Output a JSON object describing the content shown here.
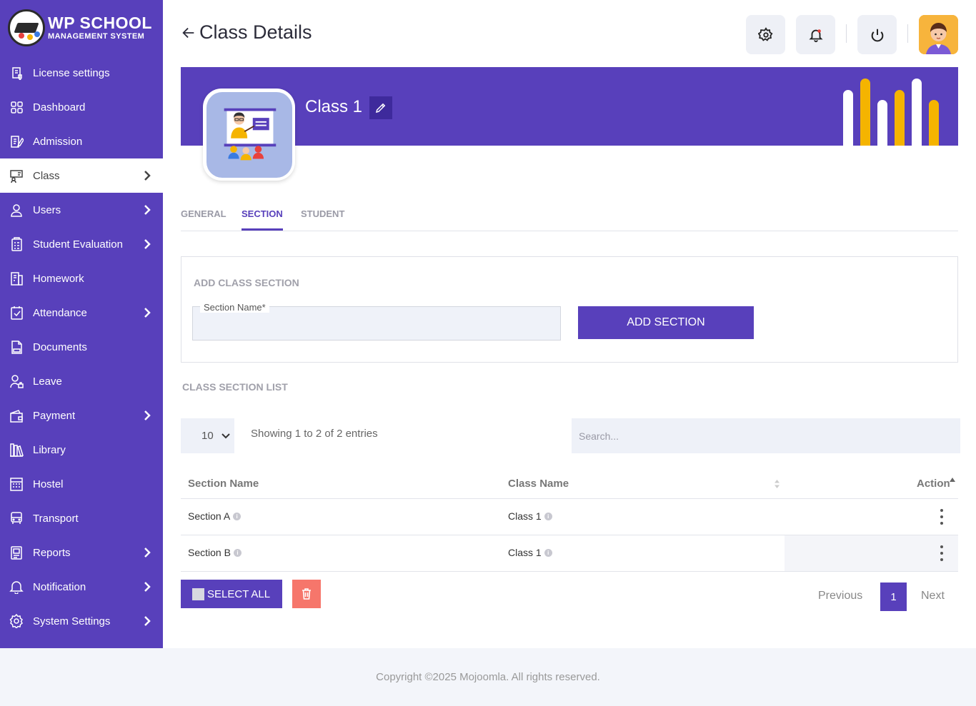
{
  "logo": {
    "title": "WP SCHOOL",
    "subtitle": "MANAGEMENT SYSTEM"
  },
  "sidebar": {
    "items": [
      {
        "label": "License settings",
        "icon": "license-icon",
        "chevron": false,
        "active": false
      },
      {
        "label": "Dashboard",
        "icon": "dashboard-icon",
        "chevron": false,
        "active": false
      },
      {
        "label": "Admission",
        "icon": "admission-icon",
        "chevron": false,
        "active": false
      },
      {
        "label": "Class",
        "icon": "class-icon",
        "chevron": true,
        "active": true
      },
      {
        "label": "Users",
        "icon": "user-icon",
        "chevron": true,
        "active": false
      },
      {
        "label": "Student Evaluation",
        "icon": "evaluation-icon",
        "chevron": true,
        "active": false
      },
      {
        "label": "Homework",
        "icon": "homework-icon",
        "chevron": false,
        "active": false
      },
      {
        "label": "Attendance",
        "icon": "attendance-icon",
        "chevron": true,
        "active": false
      },
      {
        "label": "Documents",
        "icon": "documents-icon",
        "chevron": false,
        "active": false
      },
      {
        "label": "Leave",
        "icon": "leave-icon",
        "chevron": false,
        "active": false
      },
      {
        "label": "Payment",
        "icon": "payment-icon",
        "chevron": true,
        "active": false
      },
      {
        "label": "Library",
        "icon": "library-icon",
        "chevron": false,
        "active": false
      },
      {
        "label": "Hostel",
        "icon": "hostel-icon",
        "chevron": false,
        "active": false
      },
      {
        "label": "Transport",
        "icon": "transport-icon",
        "chevron": false,
        "active": false
      },
      {
        "label": "Reports",
        "icon": "reports-icon",
        "chevron": true,
        "active": false
      },
      {
        "label": "Notification",
        "icon": "notification-icon",
        "chevron": true,
        "active": false
      },
      {
        "label": "System Settings",
        "icon": "settings-icon",
        "chevron": true,
        "active": false
      }
    ]
  },
  "header": {
    "title": "Class Details"
  },
  "banner": {
    "class_name": "Class 1"
  },
  "tabs": [
    {
      "label": "GENERAL",
      "active": false
    },
    {
      "label": "SECTION",
      "active": true
    },
    {
      "label": "STUDENT",
      "active": false
    }
  ],
  "add_section": {
    "title": "ADD CLASS SECTION",
    "field_label": "Section Name*",
    "field_value": "",
    "button": "ADD SECTION"
  },
  "list": {
    "title": "CLASS SECTION LIST",
    "page_size": "10",
    "showing": "Showing 1 to 2 of 2 entries",
    "search_placeholder": "Search...",
    "columns": [
      "Section Name",
      "Class Name",
      "Action"
    ],
    "rows": [
      {
        "section": "Section A",
        "class": "Class 1"
      },
      {
        "section": "Section B",
        "class": "Class 1"
      }
    ],
    "select_all": "SELECT ALL",
    "pagination": {
      "previous": "Previous",
      "current": "1",
      "next": "Next"
    }
  },
  "footer": {
    "text": "Copyright ©2025 Mojoomla. All rights reserved."
  },
  "colors": {
    "primary": "#5840bb",
    "accent": "#f5b400",
    "danger": "#f6766b"
  }
}
